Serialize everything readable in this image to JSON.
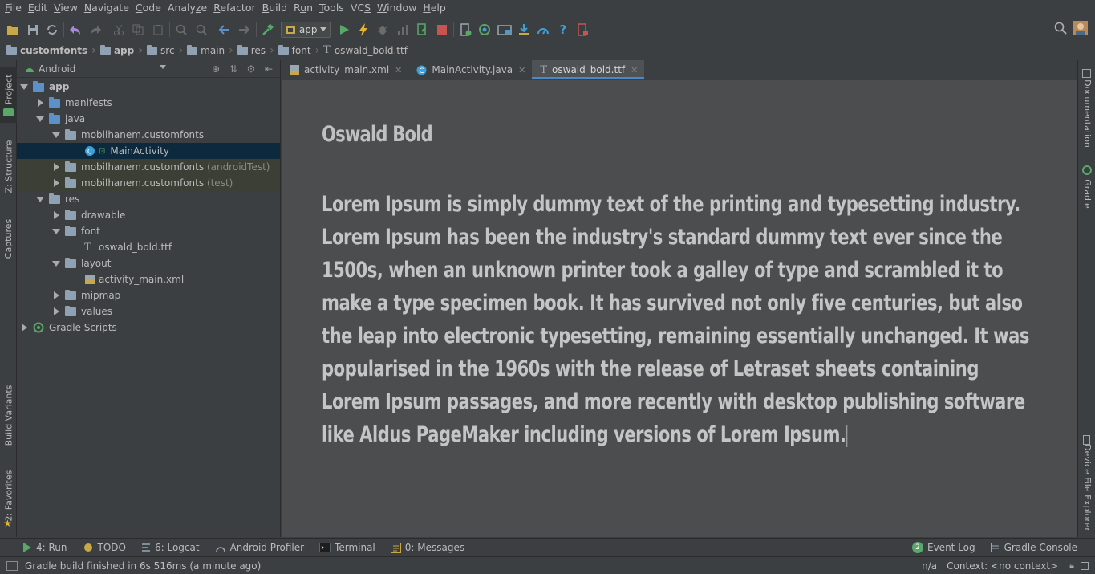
{
  "menu": [
    {
      "pre": "",
      "mn": "F",
      "post": "ile"
    },
    {
      "pre": "",
      "mn": "E",
      "post": "dit"
    },
    {
      "pre": "",
      "mn": "V",
      "post": "iew"
    },
    {
      "pre": "",
      "mn": "N",
      "post": "avigate"
    },
    {
      "pre": "",
      "mn": "C",
      "post": "ode"
    },
    {
      "pre": "Analy",
      "mn": "z",
      "post": "e"
    },
    {
      "pre": "",
      "mn": "R",
      "post": "efactor"
    },
    {
      "pre": "",
      "mn": "B",
      "post": "uild"
    },
    {
      "pre": "R",
      "mn": "u",
      "post": "n"
    },
    {
      "pre": "",
      "mn": "T",
      "post": "ools"
    },
    {
      "pre": "VC",
      "mn": "S",
      "post": ""
    },
    {
      "pre": "",
      "mn": "W",
      "post": "indow"
    },
    {
      "pre": "",
      "mn": "H",
      "post": "elp"
    }
  ],
  "toolbar": {
    "run_config": "app"
  },
  "breadcrumb": [
    "customfonts",
    "app",
    "src",
    "main",
    "res",
    "font",
    "oswald_bold.ttf"
  ],
  "left_stripe": {
    "project": "1: Project",
    "structure": "Z: Structure",
    "captures": "Captures",
    "build_variants": "Build Variants",
    "favorites": "2: Favorites"
  },
  "right_stripe": {
    "documentation": "Documentation",
    "gradle": "Gradle",
    "device_file_explorer": "Device File Explorer"
  },
  "project_panel": {
    "view": "Android",
    "tree": {
      "app": "app",
      "manifests": "manifests",
      "java": "java",
      "pkg_main": "mobilhanem.customfonts",
      "main_activity": "MainActivity",
      "pkg_android_test": "mobilhanem.customfonts",
      "pkg_android_test_suffix": "(androidTest)",
      "pkg_test": "mobilhanem.customfonts",
      "pkg_test_suffix": "(test)",
      "res": "res",
      "drawable": "drawable",
      "font": "font",
      "font_file": "oswald_bold.ttf",
      "layout": "layout",
      "layout_file": "activity_main.xml",
      "mipmap": "mipmap",
      "values": "values",
      "gradle_scripts": "Gradle Scripts"
    }
  },
  "editor_tabs": [
    {
      "label": "activity_main.xml",
      "active": false
    },
    {
      "label": "MainActivity.java",
      "active": false
    },
    {
      "label": "oswald_bold.ttf",
      "active": true
    }
  ],
  "editor": {
    "font_name": "Oswald Bold",
    "preview_text": "Lorem Ipsum is simply dummy text of the printing and typesetting industry. Lorem Ipsum has been the industry's standard dummy text ever since the 1500s, when an unknown printer took a galley of type and scrambled it to make a type specimen book. It has survived not only five centuries, but also the leap into electronic typesetting, remaining essentially unchanged. It was popularised in the 1960s with the release of Letraset sheets containing Lorem Ipsum passages, and more recently with desktop publishing software like Aldus PageMaker including versions of Lorem Ipsum."
  },
  "bottom_tools": {
    "run_mn": "4",
    "run_label": ": Run",
    "todo": "TODO",
    "logcat_mn": "6",
    "logcat_label": ": Logcat",
    "profiler": "Android Profiler",
    "terminal": "Terminal",
    "messages_mn": "0",
    "messages_label": ": Messages",
    "event_log_count": "2",
    "event_log": "Event Log",
    "gradle_console": "Gradle Console"
  },
  "status": {
    "message": "Gradle build finished in 6s 516ms (a minute ago)",
    "position": "n/a",
    "context": "Context: <no context>"
  },
  "colors": {
    "accent": "#4a88c7",
    "selection": "#0d293e",
    "run_green": "#59a869",
    "stop_red": "#c75450"
  }
}
